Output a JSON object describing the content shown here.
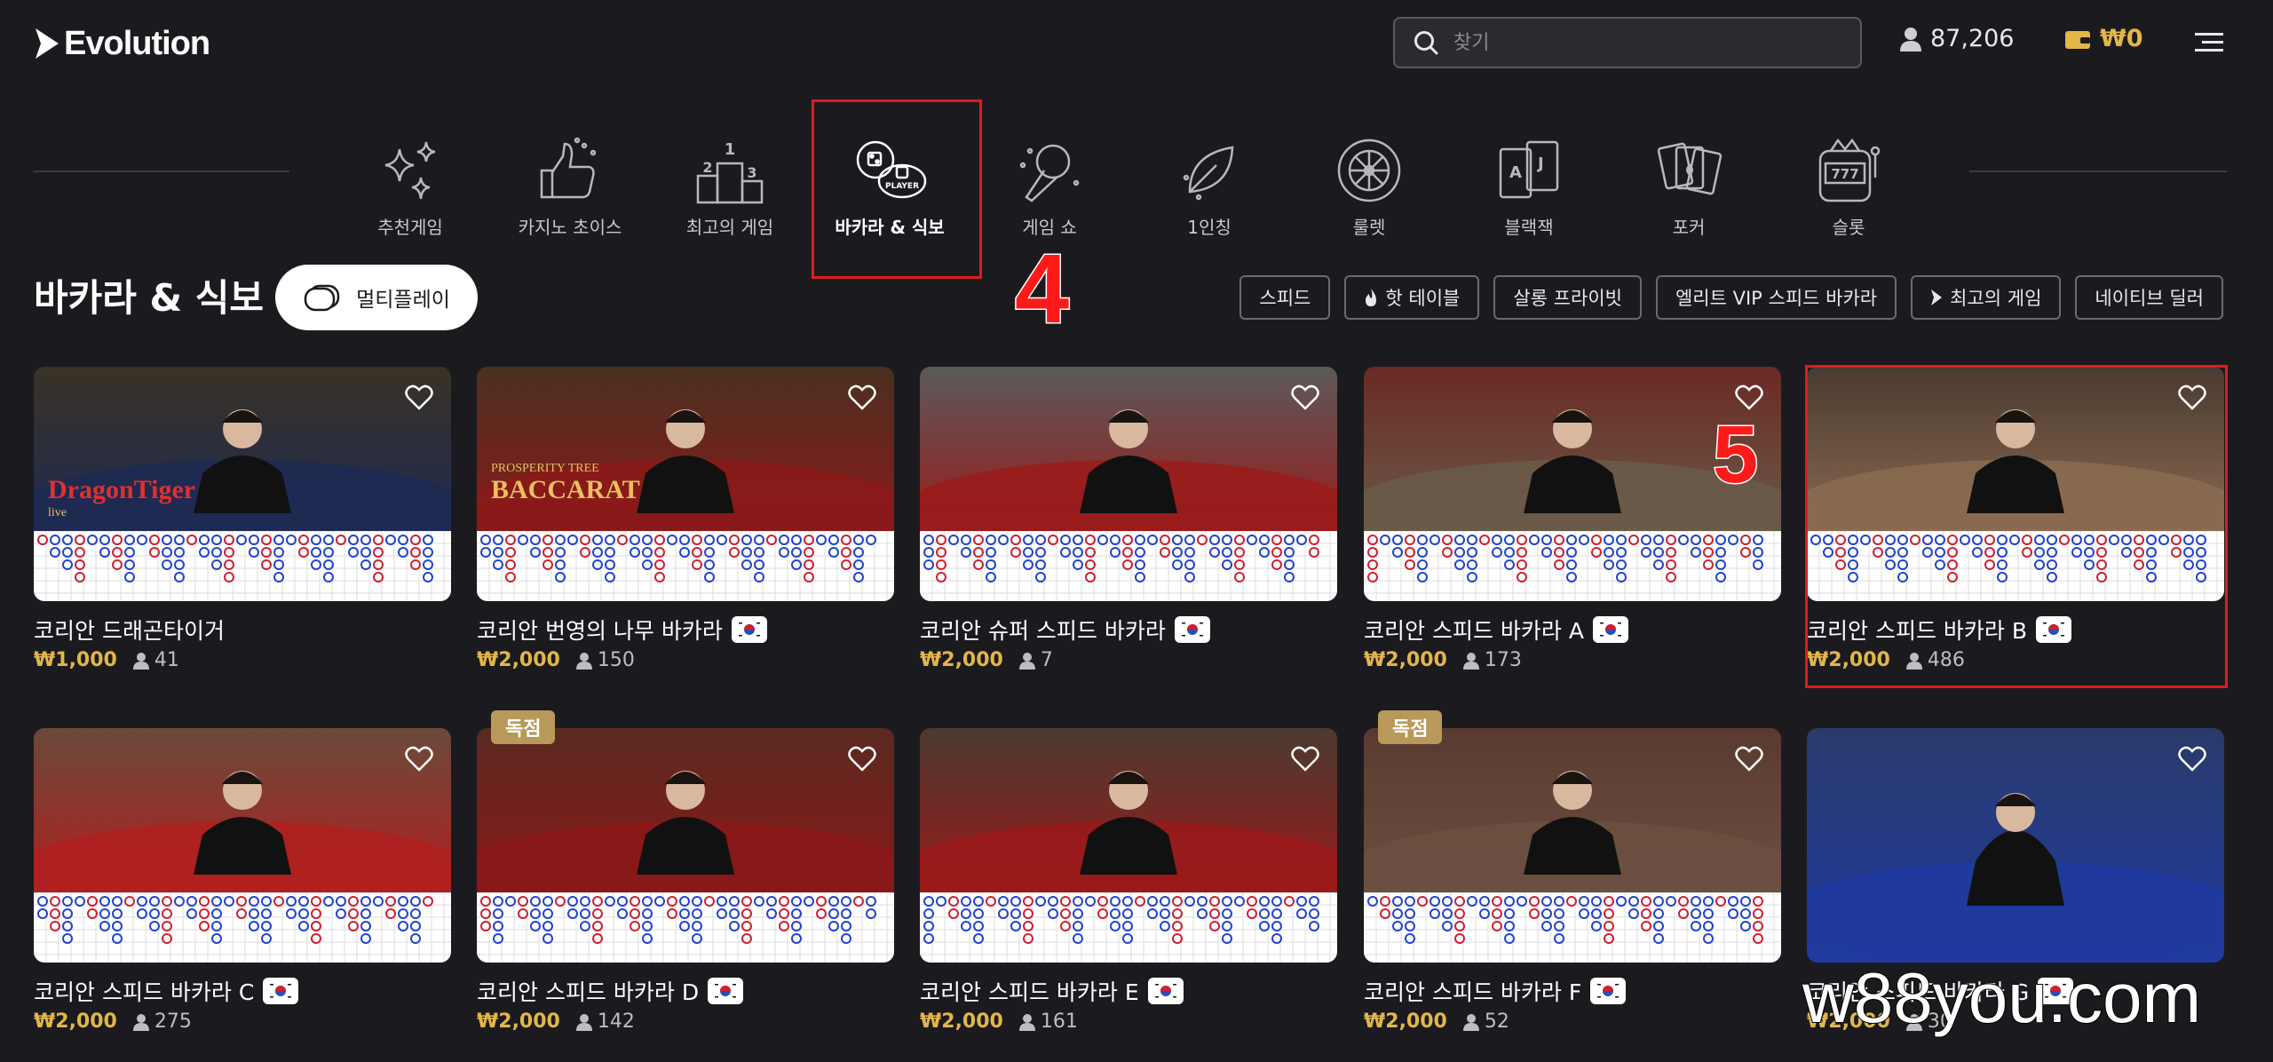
{
  "app": {
    "logo": "Evolution"
  },
  "search": {
    "placeholder": "찾기"
  },
  "header": {
    "players": "87,206",
    "balance": "₩0"
  },
  "categories": [
    {
      "label": "추천게임",
      "icon": "sparkles-icon"
    },
    {
      "label": "카지노 초이스",
      "icon": "thumbs-up-icon"
    },
    {
      "label": "최고의 게임",
      "icon": "podium-icon"
    },
    {
      "label": "바카라 & 식보",
      "icon": "baccarat-dice-icon",
      "active": true
    },
    {
      "label": "게임 쇼",
      "icon": "microphone-icon"
    },
    {
      "label": "1인칭",
      "icon": "leaf-icon"
    },
    {
      "label": "룰렛",
      "icon": "roulette-icon"
    },
    {
      "label": "블랙잭",
      "icon": "blackjack-cards-icon"
    },
    {
      "label": "포커",
      "icon": "poker-cards-icon"
    },
    {
      "label": "슬롯",
      "icon": "slot-machine-icon"
    }
  ],
  "annotations": {
    "step4": "4",
    "step5": "5"
  },
  "section": {
    "title": "바카라 & 식보",
    "multiplay_label": "멀티플레이"
  },
  "filters": [
    {
      "label": "스피드",
      "icon": ""
    },
    {
      "label": "핫 테이블",
      "icon": "flame-icon"
    },
    {
      "label": "살롱 프라이빗",
      "icon": ""
    },
    {
      "label": "엘리트 VIP 스피드 바카라",
      "icon": ""
    },
    {
      "label": "최고의 게임",
      "icon": "evolution-mark-icon"
    },
    {
      "label": "네이티브 딜러",
      "icon": ""
    }
  ],
  "games": [
    {
      "name": "코리안 드래곤타이거",
      "price": "₩1,000",
      "players": "41",
      "flag": false,
      "exclusive": "",
      "overlay_title": "DragonTiger",
      "overlay_sub": "live"
    },
    {
      "name": "코리안 번영의 나무 바카라",
      "price": "₩2,000",
      "players": "150",
      "flag": true,
      "exclusive": "",
      "overlay_title": "BACCARAT",
      "overlay_sub": "PROSPERITY TREE"
    },
    {
      "name": "코리안 슈퍼 스피드 바카라",
      "price": "₩2,000",
      "players": "7",
      "flag": true,
      "exclusive": ""
    },
    {
      "name": "코리안 스피드 바카라 A",
      "price": "₩2,000",
      "players": "173",
      "flag": true,
      "exclusive": ""
    },
    {
      "name": "코리안 스피드 바카라 B",
      "price": "₩2,000",
      "players": "486",
      "flag": true,
      "exclusive": ""
    },
    {
      "name": "코리안 스피드 바카라 C",
      "price": "₩2,000",
      "players": "275",
      "flag": true,
      "exclusive": ""
    },
    {
      "name": "코리안 스피드 바카라 D",
      "price": "₩2,000",
      "players": "142",
      "flag": true,
      "exclusive": "독점"
    },
    {
      "name": "코리안 스피드 바카라 E",
      "price": "₩2,000",
      "players": "161",
      "flag": true,
      "exclusive": ""
    },
    {
      "name": "코리안 스피드 바카라 F",
      "price": "₩2,000",
      "players": "52",
      "flag": true,
      "exclusive": "독점"
    },
    {
      "name": "코리안 스피드 바카라 G",
      "price": "₩2,000",
      "players": "30",
      "flag": true,
      "exclusive": ""
    }
  ],
  "watermark": "w88you.com",
  "colors": {
    "background": "#1b1b1f",
    "gold": "#e3b649",
    "highlight": "#e01c1c"
  }
}
